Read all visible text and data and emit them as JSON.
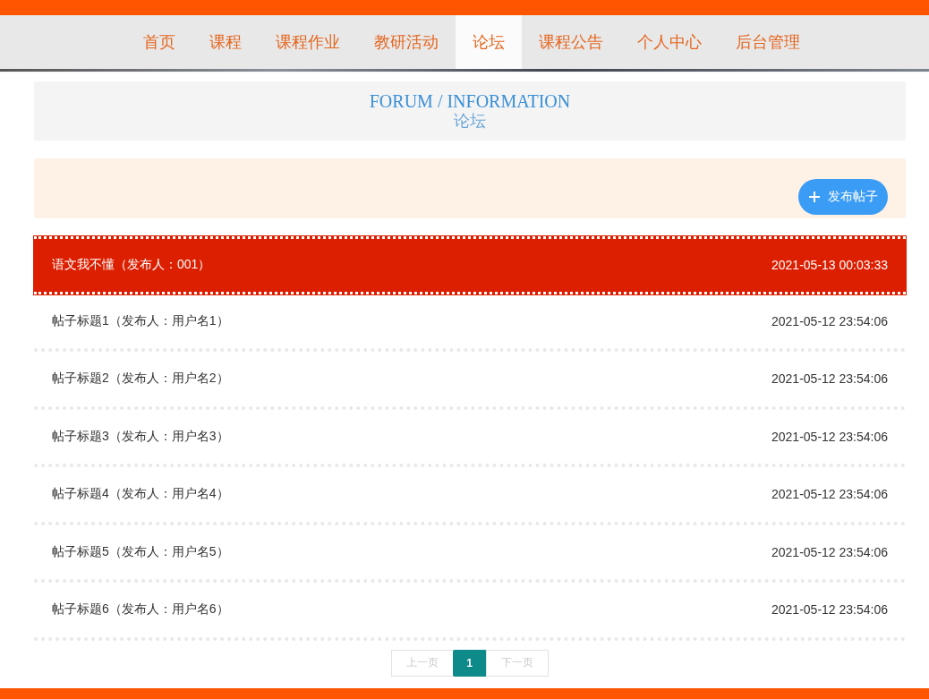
{
  "nav": [
    {
      "label": "首页",
      "selected": false
    },
    {
      "label": "课程",
      "selected": false
    },
    {
      "label": "课程作业",
      "selected": false
    },
    {
      "label": "教研活动",
      "selected": false
    },
    {
      "label": "论坛",
      "selected": true
    },
    {
      "label": "课程公告",
      "selected": false
    },
    {
      "label": "个人中心",
      "selected": false
    },
    {
      "label": "后台管理",
      "selected": false
    }
  ],
  "header": {
    "title": "FORUM / INFORMATION",
    "subtitle": "论坛"
  },
  "toolbar": {
    "button": "发布帖子"
  },
  "posts": [
    {
      "title": "语文我不懂（发布人：001）",
      "time": "2021-05-13 00:03:33",
      "highlighted": true
    },
    {
      "title": "帖子标题1（发布人：用户名1）",
      "time": "2021-05-12 23:54:06",
      "highlighted": false
    },
    {
      "title": "帖子标题2（发布人：用户名2）",
      "time": "2021-05-12 23:54:06",
      "highlighted": false
    },
    {
      "title": "帖子标题3（发布人：用户名3）",
      "time": "2021-05-12 23:54:06",
      "highlighted": false
    },
    {
      "title": "帖子标题4（发布人：用户名4）",
      "time": "2021-05-12 23:54:06",
      "highlighted": false
    },
    {
      "title": "帖子标题5（发布人：用户名5）",
      "time": "2021-05-12 23:54:06",
      "highlighted": false
    },
    {
      "title": "帖子标题6（发布人：用户名6）",
      "time": "2021-05-12 23:54:06",
      "highlighted": false
    }
  ],
  "pagination": {
    "prev": {
      "label": "上一页",
      "disabled": true
    },
    "pages": [
      {
        "label": "1",
        "selected": true
      }
    ],
    "next": {
      "label": "下一页",
      "disabled": true
    }
  }
}
